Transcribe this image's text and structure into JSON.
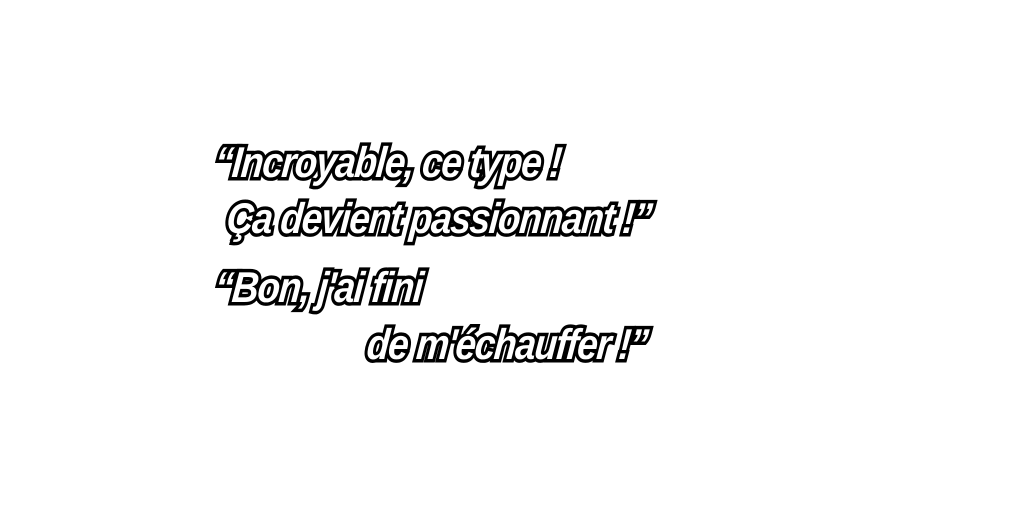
{
  "quotes": [
    {
      "lines": [
        "“Incroyable, ce type !",
        "Ça devient passionnant !”"
      ]
    },
    {
      "lines": [
        "“Bon, j'ai fini",
        "de m'échauffer !”"
      ]
    }
  ]
}
